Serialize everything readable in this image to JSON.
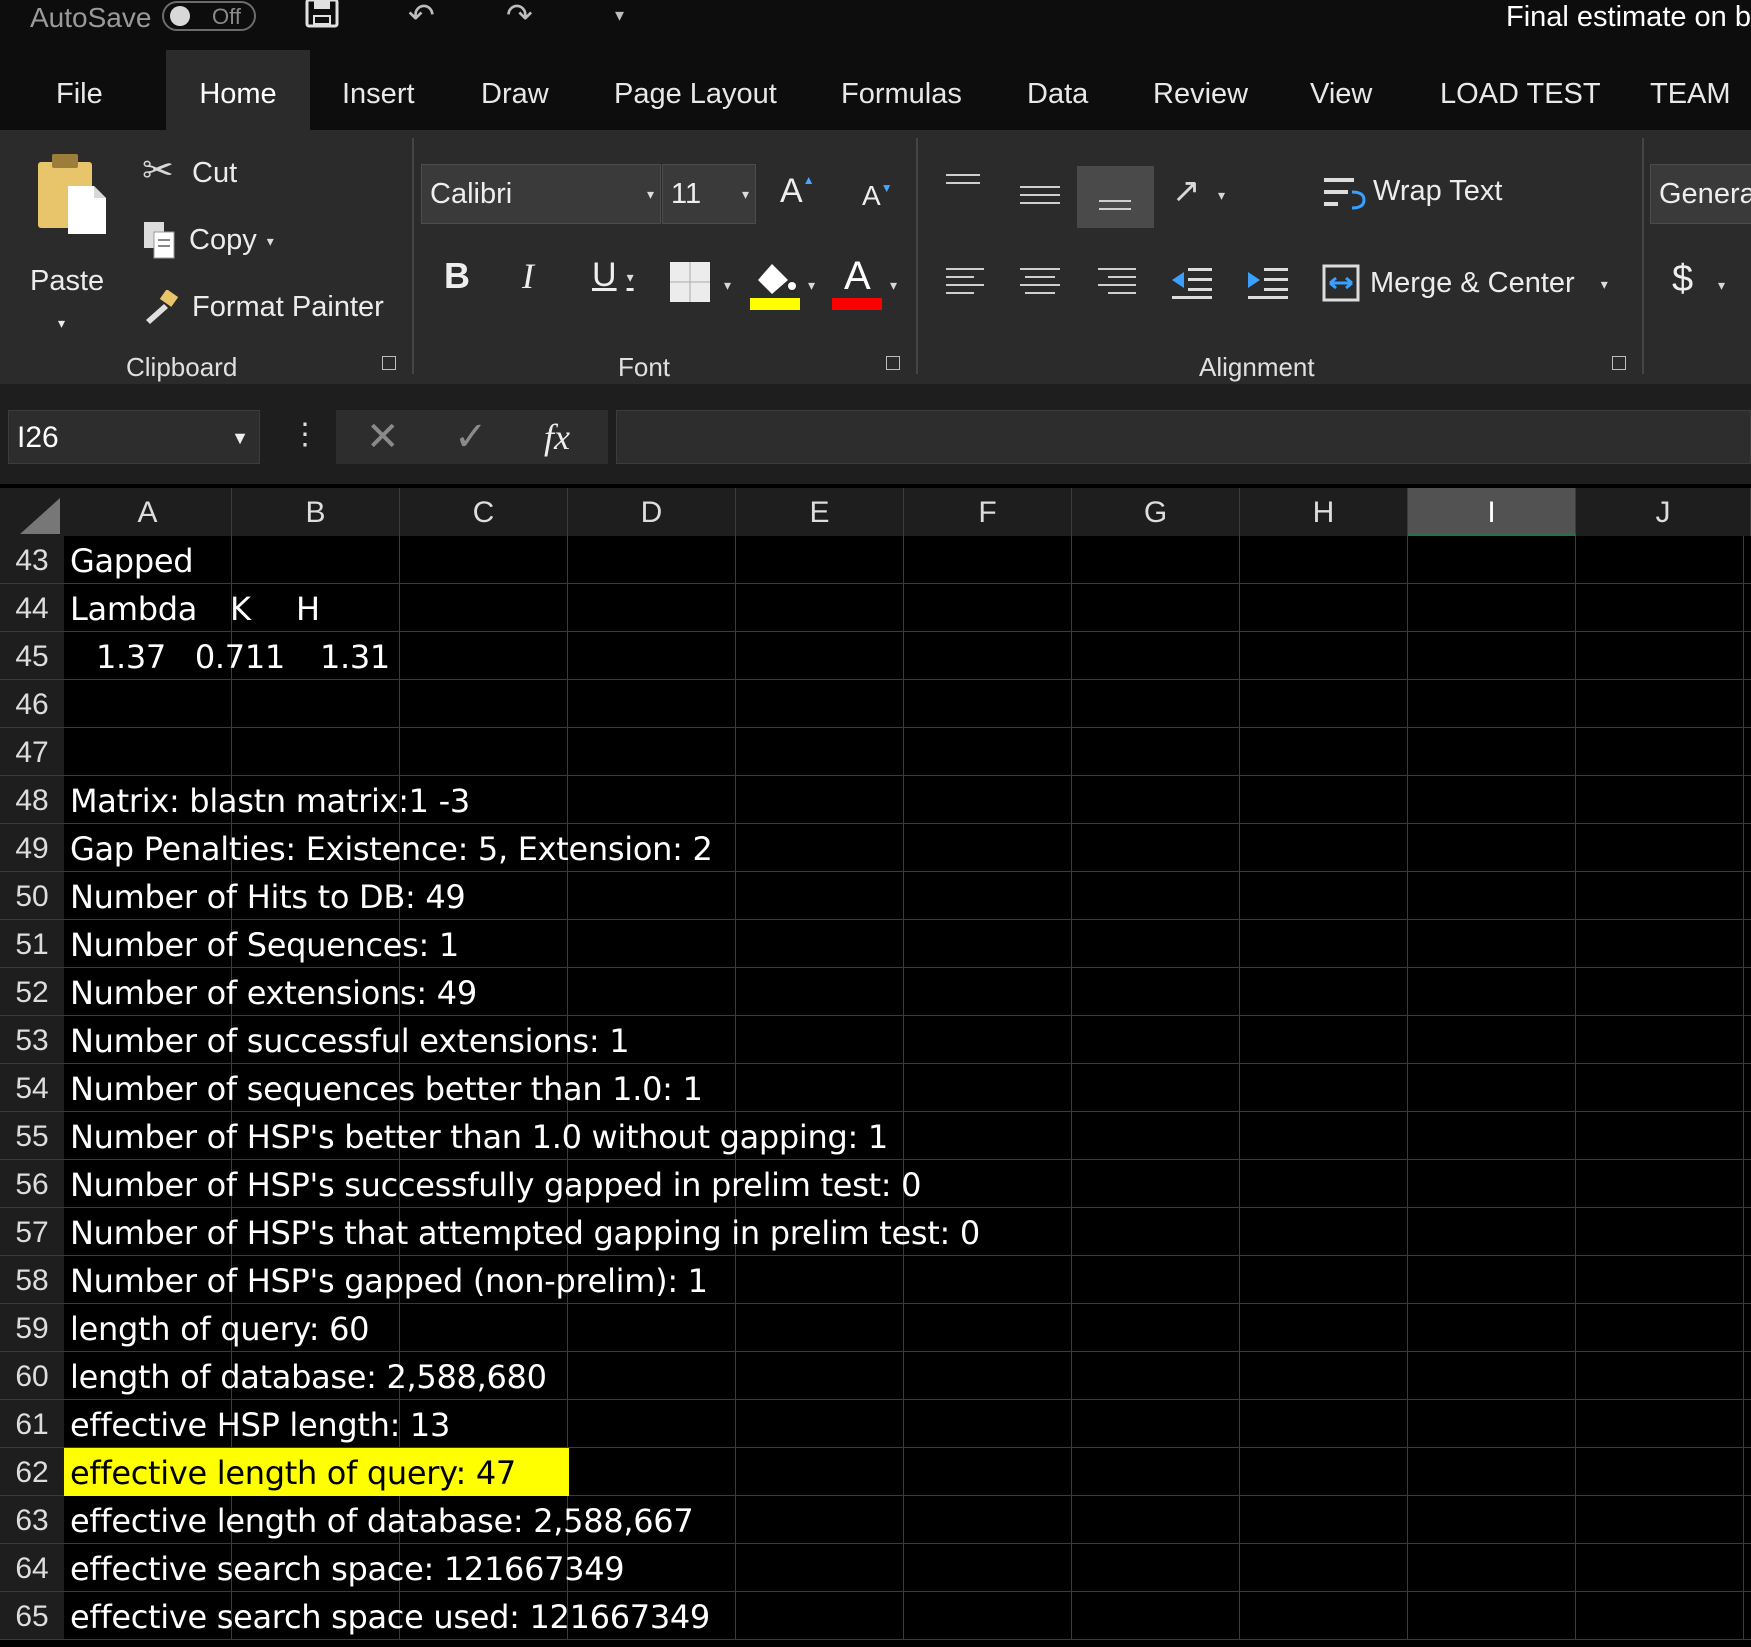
{
  "titlebar": {
    "autosave_label": "AutoSave",
    "autosave_state": "Off",
    "document_title": "Final estimate on b"
  },
  "tabs": [
    "File",
    "Home",
    "Insert",
    "Draw",
    "Page Layout",
    "Formulas",
    "Data",
    "Review",
    "View",
    "LOAD TEST",
    "TEAM"
  ],
  "active_tab": "Home",
  "ribbon": {
    "clipboard": {
      "paste": "Paste",
      "cut": "Cut",
      "copy": "Copy",
      "format_painter": "Format Painter",
      "label": "Clipboard"
    },
    "font": {
      "font_name": "Calibri",
      "font_size": "11",
      "bold": "B",
      "italic": "I",
      "underline": "U",
      "font_color_glyph": "A",
      "grow_glyph": "A",
      "shrink_glyph": "A",
      "label": "Font",
      "highlight_color": "#ffff00",
      "font_color": "#ff0000"
    },
    "alignment": {
      "wrap_text": "Wrap Text",
      "merge_center": "Merge & Center",
      "label": "Alignment"
    },
    "number": {
      "format": "Genera",
      "currency": "$"
    }
  },
  "formula_bar": {
    "name_box": "I26",
    "fx": "fx",
    "formula": ""
  },
  "grid": {
    "columns": [
      "A",
      "B",
      "C",
      "D",
      "E",
      "F",
      "G",
      "H",
      "I",
      "J"
    ],
    "selected_column": "I",
    "rows": [
      {
        "num": "43",
        "cells": [
          {
            "col": "A",
            "text": "Gapped"
          }
        ]
      },
      {
        "num": "44",
        "cells": [
          {
            "col": "A",
            "text": "Lambda"
          },
          {
            "col": "B1",
            "text": "K"
          },
          {
            "col": "B2",
            "text": "H"
          }
        ]
      },
      {
        "num": "45",
        "cells": [
          {
            "col": "A",
            "text": "1.37"
          },
          {
            "col": "B1",
            "text": "0.711"
          },
          {
            "col": "B2",
            "text": "1.31"
          }
        ]
      },
      {
        "num": "46",
        "cells": []
      },
      {
        "num": "47",
        "cells": []
      },
      {
        "num": "48",
        "cells": [
          {
            "col": "A",
            "text": "Matrix: blastn matrix:1 -3"
          }
        ]
      },
      {
        "num": "49",
        "cells": [
          {
            "col": "A",
            "text": "Gap Penalties: Existence: 5, Extension: 2"
          }
        ]
      },
      {
        "num": "50",
        "cells": [
          {
            "col": "A",
            "text": "Number of Hits to DB: 49"
          }
        ]
      },
      {
        "num": "51",
        "cells": [
          {
            "col": "A",
            "text": "Number of Sequences: 1"
          }
        ]
      },
      {
        "num": "52",
        "cells": [
          {
            "col": "A",
            "text": "Number of extensions: 49"
          }
        ]
      },
      {
        "num": "53",
        "cells": [
          {
            "col": "A",
            "text": "Number of successful extensions: 1"
          }
        ]
      },
      {
        "num": "54",
        "cells": [
          {
            "col": "A",
            "text": "Number of sequences better than  1.0: 1"
          }
        ]
      },
      {
        "num": "55",
        "cells": [
          {
            "col": "A",
            "text": "Number of HSP's better than  1.0 without gapping: 1"
          }
        ]
      },
      {
        "num": "56",
        "cells": [
          {
            "col": "A",
            "text": "Number of HSP's successfully gapped in prelim test: 0"
          }
        ]
      },
      {
        "num": "57",
        "cells": [
          {
            "col": "A",
            "text": "Number of HSP's that attempted gapping in prelim test: 0"
          }
        ]
      },
      {
        "num": "58",
        "cells": [
          {
            "col": "A",
            "text": "Number of HSP's gapped (non-prelim): 1"
          }
        ]
      },
      {
        "num": "59",
        "cells": [
          {
            "col": "A",
            "text": "length of query: 60"
          }
        ]
      },
      {
        "num": "60",
        "cells": [
          {
            "col": "A",
            "text": "length of database: 2,588,680"
          }
        ]
      },
      {
        "num": "61",
        "cells": [
          {
            "col": "A",
            "text": "effective HSP length: 13"
          }
        ]
      },
      {
        "num": "62",
        "cells": [
          {
            "col": "A",
            "text": "effective length of query: 47"
          }
        ],
        "highlight": "#ffff00"
      },
      {
        "num": "63",
        "cells": [
          {
            "col": "A",
            "text": "effective length of database: 2,588,667"
          }
        ]
      },
      {
        "num": "64",
        "cells": [
          {
            "col": "A",
            "text": "effective search space: 121667349"
          }
        ]
      },
      {
        "num": "65",
        "cells": [
          {
            "col": "A",
            "text": "effective search space used: 121667349"
          }
        ]
      }
    ]
  }
}
